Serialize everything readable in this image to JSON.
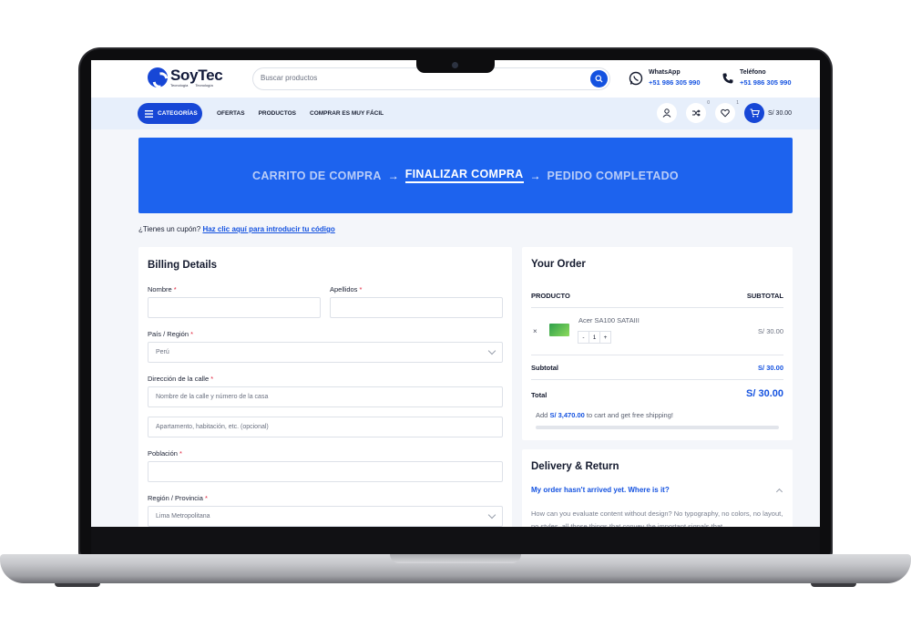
{
  "header": {
    "logo_name": "SoyTec",
    "logo_tag_left": "Tecnología",
    "logo_tag_right": "Tecnología",
    "search_placeholder": "Buscar productos",
    "whatsapp_label": "WhatsApp",
    "whatsapp_number": "+51 986 305 990",
    "phone_label": "Teléfono",
    "phone_number": "+51 986 305 990"
  },
  "nav": {
    "categories_label": "CATEGORÍAS",
    "links": [
      "OFERTAS",
      "PRODUCTOS",
      "COMPRAR ES MUY FÁCIL"
    ],
    "compare_count": "0",
    "wishlist_count": "1",
    "cart_total": "S/ 30.00"
  },
  "steps": {
    "cart": "CARRITO DE COMPRA",
    "checkout": "FINALIZAR COMPRA",
    "complete": "PEDIDO COMPLETADO",
    "arrow": "→"
  },
  "coupon": {
    "text": "¿Tienes un cupón?",
    "link": "Haz clic aquí para introducir tu código"
  },
  "billing": {
    "title": "Billing Details",
    "first_name_label": "Nombre",
    "last_name_label": "Apellidos",
    "country_label": "País / Región",
    "country_value": "Perú",
    "street_label": "Dirección de la calle",
    "street_placeholder": "Nombre de la calle y número de la casa",
    "street2_placeholder": "Apartamento, habitación, etc. (opcional)",
    "city_label": "Población",
    "region_label": "Región / Provincia",
    "region_value": "Lima Metropolitana",
    "required_mark": "*"
  },
  "order": {
    "title": "Your Order",
    "col_product": "PRODUCTO",
    "col_subtotal": "SUBTOTAL",
    "item_name": "Acer SA100 SATAIII",
    "item_qty": "1",
    "item_price": "S/ 30.00",
    "subtotal_label": "Subtotal",
    "subtotal_value": "S/ 30.00",
    "total_label": "Total",
    "total_value": "S/ 30.00",
    "shipping_pre": "Add",
    "shipping_amount": "S/ 3,470.00",
    "shipping_post": "to cart and get free shipping!",
    "shipping_progress": 0
  },
  "delivery": {
    "title": "Delivery & Return",
    "question": "My order hasn't arrived yet. Where is it?",
    "answer": "How can you evaluate content without design? No typography, no colors, no layout, no styles, all those things that convey the important signals that"
  },
  "colors": {
    "accent": "#1747d6",
    "hero": "#1d63ee",
    "link": "#1452e0",
    "required": "#e0203a"
  }
}
